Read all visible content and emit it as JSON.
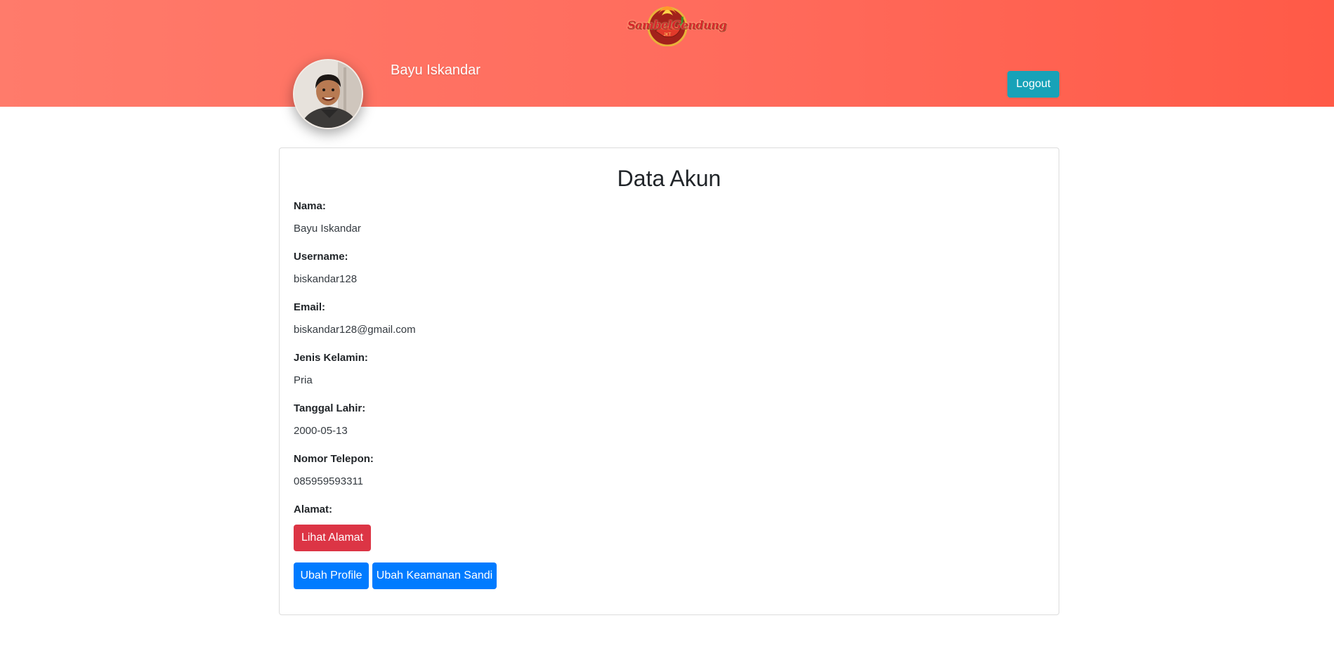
{
  "header": {
    "logo_text": "SambelGendung",
    "logo_sub": "JKT",
    "user_name": "Bayu Iskandar",
    "logout_label": "Logout"
  },
  "card": {
    "title": "Data Akun",
    "fields": [
      {
        "label": "Nama:",
        "value": "Bayu Iskandar"
      },
      {
        "label": "Username:",
        "value": "biskandar128"
      },
      {
        "label": "Email:",
        "value": "biskandar128@gmail.com"
      },
      {
        "label": "Jenis Kelamin:",
        "value": "Pria"
      },
      {
        "label": "Tanggal Lahir:",
        "value": "2000-05-13"
      },
      {
        "label": "Nomor Telepon:",
        "value": "085959593311"
      },
      {
        "label": "Alamat:",
        "value": ""
      }
    ],
    "lihat_alamat_label": "Lihat Alamat",
    "ubah_profile_label": "Ubah Profile",
    "ubah_sandi_label": "Ubah Keamanan Sandi"
  },
  "colors": {
    "header_gradient_start": "#ff7b6b",
    "header_gradient_end": "#ff5a47",
    "logout_button": "#17a2b8",
    "danger_button": "#dc3545",
    "primary_button": "#007bff"
  }
}
